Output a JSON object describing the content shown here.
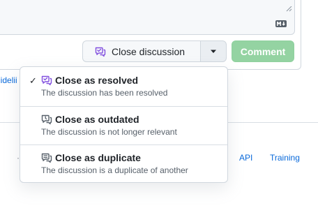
{
  "composer": {
    "markdown_icon": "markdown-icon"
  },
  "actions": {
    "close_label": "Close discussion",
    "close_icon": "discussion-closed-icon",
    "caret_icon": "triangle-down-icon",
    "comment_label": "Comment"
  },
  "background": {
    "left_link_fragment": "uidelii",
    "footer_hint": "·",
    "footer_links": [
      "API",
      "Training"
    ]
  },
  "menu": {
    "items": [
      {
        "title": "Close as resolved",
        "description": "The discussion has been resolved",
        "selected": true,
        "icon": "discussion-closed-icon",
        "icon_color": "#8250df"
      },
      {
        "title": "Close as outdated",
        "description": "The discussion is not longer relevant",
        "selected": false,
        "icon": "discussion-outdated-icon",
        "icon_color": "#57606a"
      },
      {
        "title": "Close as duplicate",
        "description": "The discussion is a duplicate of another",
        "selected": false,
        "icon": "discussion-duplicate-icon",
        "icon_color": "#57606a"
      }
    ],
    "check_glyph": "✓"
  },
  "colors": {
    "accent_purple": "#8250df",
    "comment_green": "#94d3a2",
    "link_blue": "#0969da"
  }
}
